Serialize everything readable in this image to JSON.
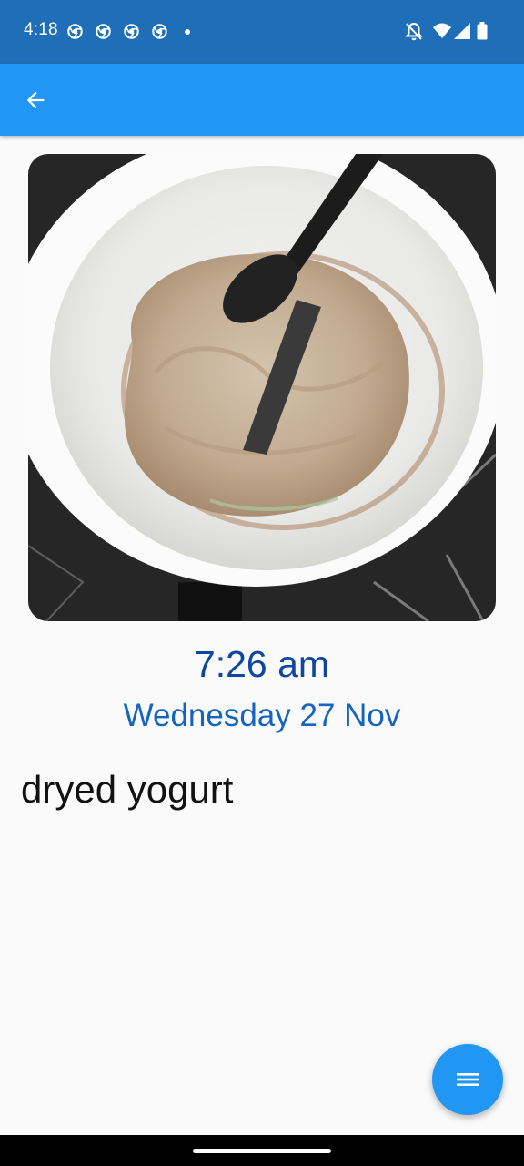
{
  "status_bar": {
    "time": "4:18",
    "notification_icons": [
      "chrome-icon",
      "chrome-icon",
      "chrome-icon",
      "chrome-icon"
    ],
    "system_icons": [
      "bell-off-icon",
      "wifi-icon",
      "signal-icon",
      "battery-icon"
    ]
  },
  "app_bar": {
    "back_icon": "arrow-back-icon",
    "color": "#2196f3"
  },
  "entry": {
    "photo_subject": "white bowl with dried yogurt and black spoon",
    "time": "7:26 am",
    "date": "Wednesday 27 Nov",
    "note": "dryed yogurt"
  },
  "fab": {
    "icon": "menu-icon"
  },
  "colors": {
    "status_bar": "#1f6fb8",
    "accent": "#2196f3",
    "time_text": "#0d47a1",
    "date_text": "#1565c0"
  }
}
